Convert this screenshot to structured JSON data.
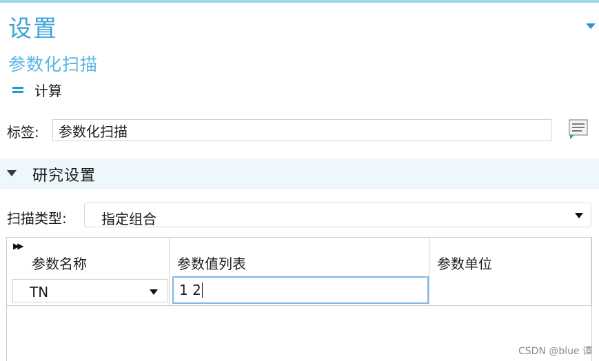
{
  "header": {
    "title": "设置",
    "subtitle": "参数化扫描",
    "compute_label": "计算"
  },
  "label_row": {
    "label": "标签:",
    "value": "参数化扫描"
  },
  "section": {
    "title": "研究设置"
  },
  "sweep": {
    "label": "扫描类型:",
    "selected": "指定组合"
  },
  "table": {
    "headers": [
      "参数名称",
      "参数值列表",
      "参数单位"
    ],
    "rows": [
      {
        "name": "TN",
        "values": "1 2",
        "unit": ""
      }
    ]
  },
  "watermark": "CSDN @blue 谭",
  "colors": {
    "accent": "#3ea3d8",
    "section_bg": "#eef7fb",
    "focus_border": "#7fb6e8"
  }
}
